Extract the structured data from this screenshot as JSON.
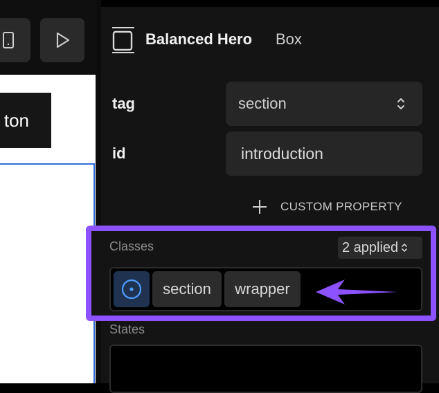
{
  "panel": {
    "title": "Balanced Hero",
    "subtitle": "Box",
    "tag_label": "tag",
    "tag_value": "section",
    "id_label": "id",
    "id_value": "introduction",
    "custom_property_label": "CUSTOM PROPERTY",
    "classes_label": "Classes",
    "classes_applied": "2 applied",
    "class_chips": [
      "section",
      "wrapper"
    ],
    "states_label": "States"
  },
  "canvas": {
    "button_text": "ton"
  },
  "colors": {
    "accent": "#8c52ff",
    "selection": "#2f6fe0"
  }
}
